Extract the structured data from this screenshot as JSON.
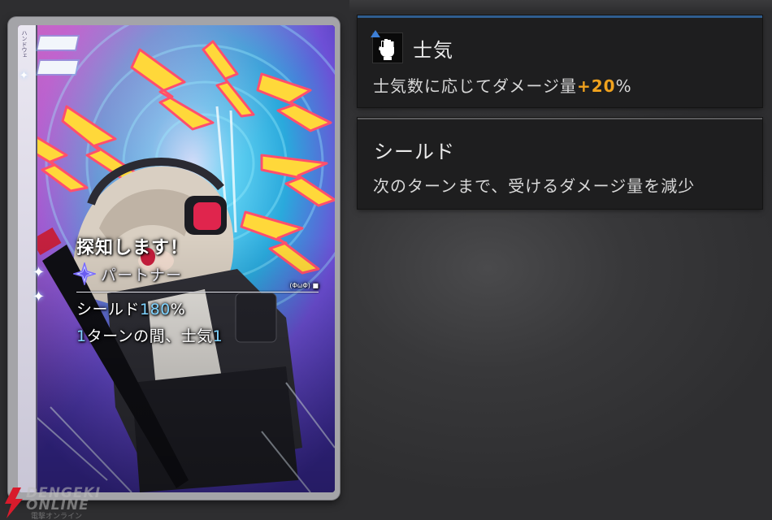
{
  "card": {
    "side_text": "ハンドウェ",
    "title": "探知します！",
    "type_label": "パートナー",
    "divider_mark": "(ΦωΦ) ■",
    "effects": [
      {
        "prefix": "シールド",
        "value": "180",
        "suffix": "%"
      },
      {
        "prefix": "",
        "value": "1",
        "suffix": "ターンの間、士気",
        "value2": "1"
      }
    ]
  },
  "panels": {
    "morale": {
      "title": "士気",
      "icon": "raised-fist-icon",
      "desc_prefix": "士気数に応じてダメージ量",
      "desc_value": "+20",
      "desc_suffix": "%"
    },
    "shield": {
      "title": "シールド",
      "desc": "次のターンまで、受けるダメージ量を減少"
    }
  },
  "watermark": {
    "text_line1": "DENGEKI",
    "text_line2": "ONLINE",
    "sub": "電撃オンライン"
  },
  "colors": {
    "highlight_blue": "#7fd3ff",
    "highlight_orange": "#f0a21e",
    "panel_bg": "#1e1e1f",
    "morale_accent": "#2f5d8f"
  }
}
